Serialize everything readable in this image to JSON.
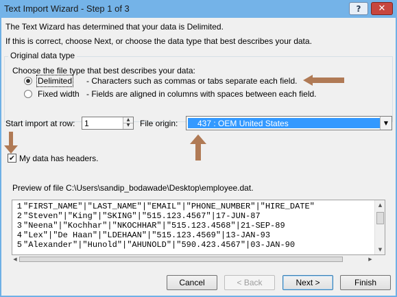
{
  "window": {
    "title": "Text Import Wizard - Step 1 of 3",
    "help_label": "?",
    "close_label": "✕"
  },
  "intro": {
    "line1": "The Text Wizard has determined that your data is Delimited.",
    "line2": "If this is correct, choose Next, or choose the data type that best describes your data."
  },
  "original_type": {
    "legend": "Original data type",
    "prompt": "Choose the file type that best describes your data:",
    "options": [
      {
        "label": "Delimited",
        "description": "- Characters such as commas or tabs separate each field.",
        "selected": true
      },
      {
        "label": "Fixed width",
        "description": "- Fields are aligned in columns with spaces between each field.",
        "selected": false
      }
    ]
  },
  "start_import": {
    "label": "Start import at row:",
    "value": "1"
  },
  "file_origin": {
    "label": "File origin:",
    "value": "437 : OEM United States"
  },
  "headers_checkbox": {
    "label": "My data has headers.",
    "checked": true
  },
  "preview": {
    "label": "Preview of file C:\\Users\\sandip_bodawade\\Desktop\\employee.dat.",
    "rows": [
      {
        "num": "1",
        "text": "\"FIRST_NAME\"|\"LAST_NAME\"|\"EMAIL\"|\"PHONE_NUMBER\"|\"HIRE_DATE\""
      },
      {
        "num": "2",
        "text": "\"Steven\"|\"King\"|\"SKING\"|\"515.123.4567\"|17-JUN-87"
      },
      {
        "num": "3",
        "text": "\"Neena\"|\"Kochhar\"|\"NKOCHHAR\"|\"515.123.4568\"|21-SEP-89"
      },
      {
        "num": "4",
        "text": "\"Lex\"|\"De Haan\"|\"LDEHAAN\"|\"515.123.4569\"|13-JAN-93"
      },
      {
        "num": "5",
        "text": "\"Alexander\"|\"Hunold\"|\"AHUNOLD\"|\"590.423.4567\"|03-JAN-90"
      }
    ]
  },
  "buttons": {
    "cancel": "Cancel",
    "back": "< Back",
    "next": "Next >",
    "finish": "Finish"
  },
  "colors": {
    "annotation_arrow": "#b07a55",
    "selection": "#3399ff"
  }
}
